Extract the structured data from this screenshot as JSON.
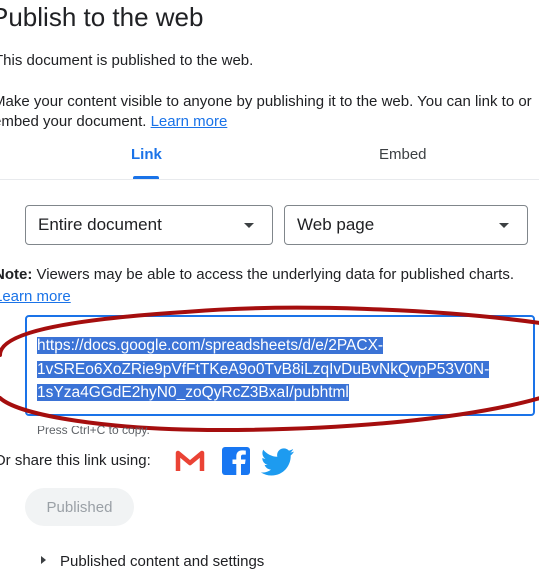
{
  "dialog": {
    "title": "Publish to the web",
    "status": "This document is published to the web.",
    "description": "Make your content visible to anyone by publishing it to the web. You can link to or embed your document.",
    "learn_more": "Learn more"
  },
  "tabs": [
    {
      "label": "Link",
      "selected": true
    },
    {
      "label": "Embed",
      "selected": false
    }
  ],
  "selects": {
    "document": {
      "value": "Entire document"
    },
    "format": {
      "value": "Web page"
    }
  },
  "note": {
    "label": "Note:",
    "text": " Viewers may be able to access the underlying data for published charts.",
    "learn_more": "Learn more"
  },
  "url": {
    "lines": [
      "https://docs.google.com/spreadsheets/d/e/2PACX-",
      "1vSREo6XoZRie9pVfFtTKeA9o0TvB8iLzqIvDuBvNkQvpP53V0N-",
      "1sYza4GGdE2hyN0_zoQyRcZ3BxaI/pubhtml"
    ],
    "copy_hint": "Press Ctrl+C to copy."
  },
  "share": {
    "label": "Or share this link using:",
    "icons": [
      "gmail-icon",
      "facebook-icon",
      "twitter-icon"
    ]
  },
  "published_button": {
    "label": "Published",
    "enabled": false
  },
  "settings": {
    "label": "Published content and settings"
  },
  "colors": {
    "accent": "#1a73e8",
    "selection": "#3b73d6",
    "annotation": "#a50e0e",
    "gmail": "#ea4335",
    "facebook": "#1877f2",
    "twitter": "#1d9bf0"
  }
}
